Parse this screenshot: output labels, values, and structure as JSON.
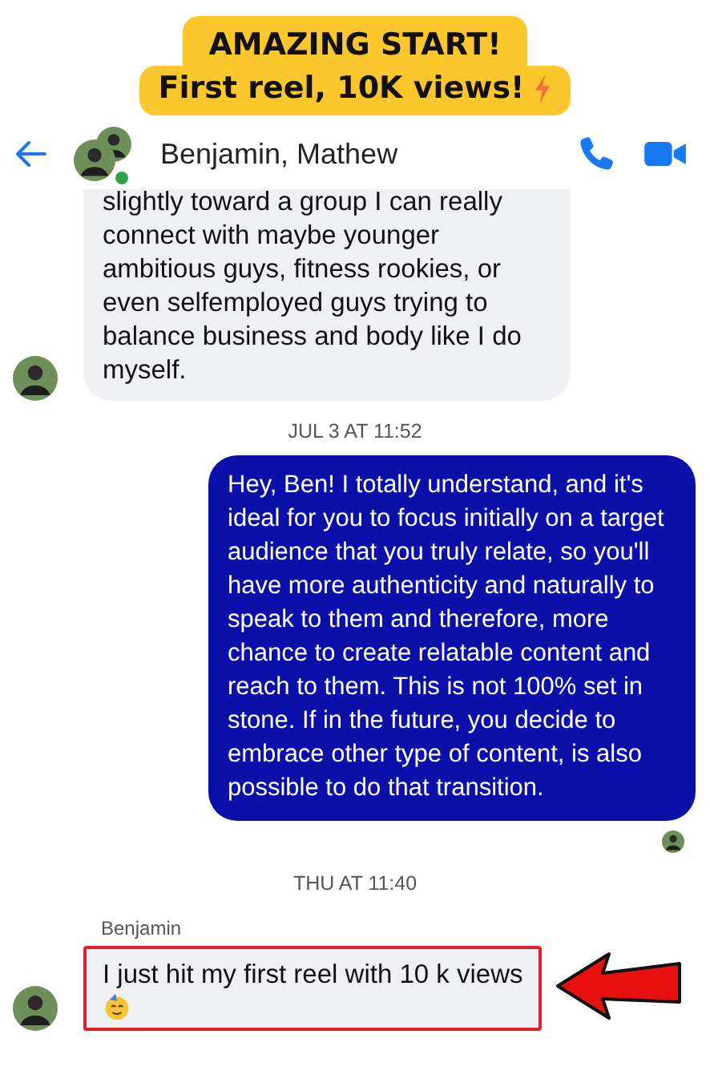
{
  "banner": {
    "lines": [
      "AMAZING START!",
      "First reel, 10K views!"
    ]
  },
  "header": {
    "title": "Benjamin, Mathew",
    "online": true
  },
  "messages": [
    {
      "kind": "received",
      "text": "slightly toward a group I can really connect with maybe younger ambitious guys, fitness rookies, or even selfemployed guys trying to balance business and body like I do myself.",
      "avatar": true,
      "highlighted": false
    },
    {
      "kind": "time",
      "text": "JUL 3 AT 11:52"
    },
    {
      "kind": "sent",
      "text": "Hey, Ben! I totally understand, and it's ideal for you to focus initially on a target audience that you truly relate, so you'll have more authenticity and naturally to speak to them and therefore, more chance to create relatable content and reach to them. This is not 100% set in stone. If in the future, you decide to embrace other type of content, is also possible to do that transition.",
      "seen": true
    },
    {
      "kind": "time",
      "text": "THU AT 11:40"
    },
    {
      "kind": "sender",
      "text": "Benjamin"
    },
    {
      "kind": "received",
      "text": "I just hit my first reel with 10 k views",
      "emoji": true,
      "avatar": true,
      "highlighted": true
    }
  ]
}
